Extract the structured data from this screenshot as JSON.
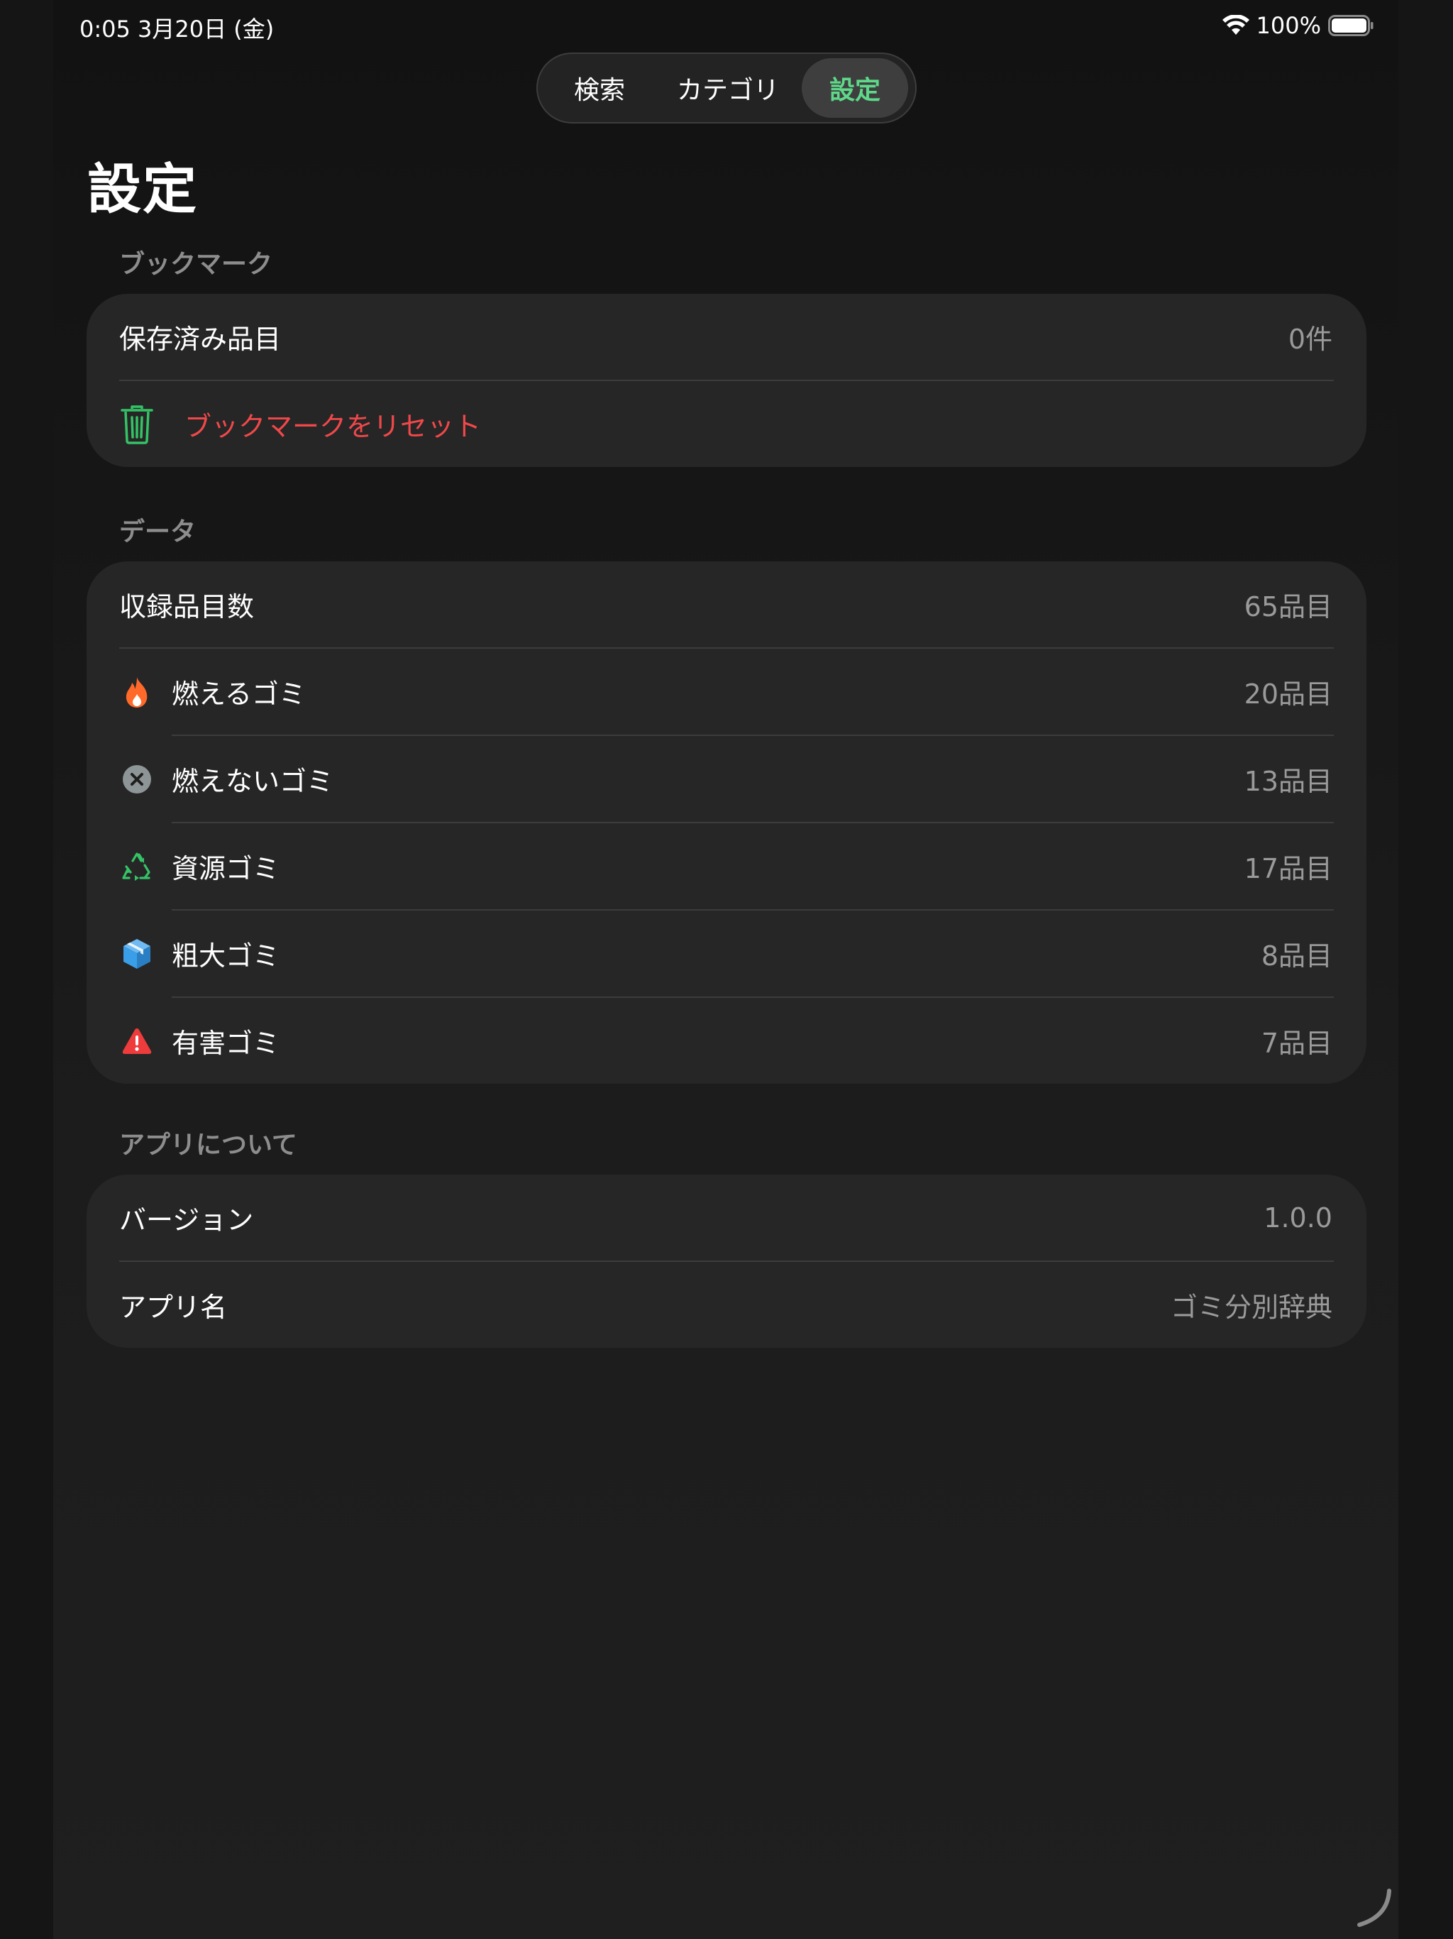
{
  "status_bar": {
    "time_date": "0:05   3月20日 (金)",
    "battery_percent": "100%",
    "wifi_icon": "wifi-icon",
    "battery_icon": "battery-icon",
    "battery_level": 1.0
  },
  "tabs": [
    {
      "label": "検索",
      "active": false
    },
    {
      "label": "カテゴリ",
      "active": false
    },
    {
      "label": "設定",
      "active": true
    }
  ],
  "page_title": "設定",
  "sections": {
    "bookmark": {
      "header": "ブックマーク",
      "saved_label": "保存済み品目",
      "saved_value": "0件",
      "reset_label": "ブックマークをリセット",
      "reset_icon": "trash-icon"
    },
    "data": {
      "header": "データ",
      "total_label": "収録品目数",
      "total_value": "65品目",
      "categories": [
        {
          "label": "燃えるゴミ",
          "value": "20品目",
          "icon": "flame-icon",
          "color": "#ff6a2b"
        },
        {
          "label": "燃えないゴミ",
          "value": "13品目",
          "icon": "xmark-circle-icon",
          "color": "#8e9596"
        },
        {
          "label": "資源ゴミ",
          "value": "17品目",
          "icon": "recycle-icon",
          "color": "#35c366"
        },
        {
          "label": "粗大ゴミ",
          "value": "8品目",
          "icon": "cube-icon",
          "color": "#3a9ee8"
        },
        {
          "label": "有害ゴミ",
          "value": "7品目",
          "icon": "warning-triangle-icon",
          "color": "#ee3b3b"
        }
      ]
    },
    "about": {
      "header": "アプリについて",
      "version_label": "バージョン",
      "version_value": "1.0.0",
      "appname_label": "アプリ名",
      "appname_value": "ゴミ分別辞典"
    }
  },
  "colors": {
    "accent_green": "#5fd88a",
    "danger_red": "#f0484a",
    "card_bg": "#262626"
  }
}
